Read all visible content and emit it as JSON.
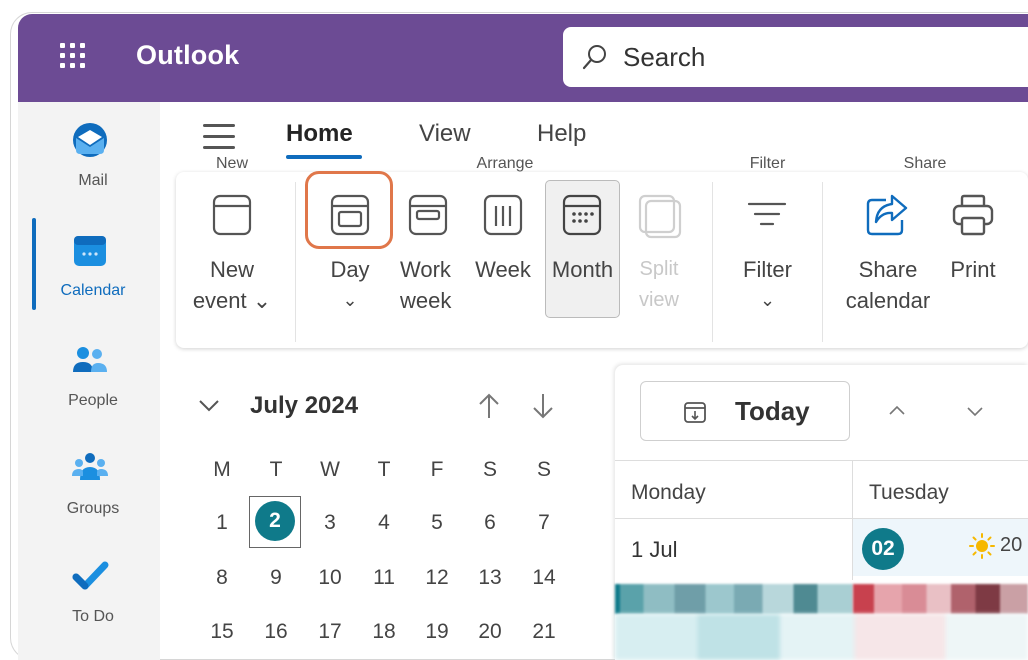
{
  "app": {
    "name": "Outlook"
  },
  "search": {
    "placeholder": "Search"
  },
  "rail": {
    "items": [
      {
        "label": "Mail",
        "icon": "mail-icon"
      },
      {
        "label": "Calendar",
        "icon": "calendar-icon"
      },
      {
        "label": "People",
        "icon": "people-icon"
      },
      {
        "label": "Groups",
        "icon": "groups-icon"
      },
      {
        "label": "To Do",
        "icon": "todo-check-icon"
      }
    ],
    "active": "Calendar"
  },
  "tabs": [
    {
      "label": "Home",
      "active": true
    },
    {
      "label": "View"
    },
    {
      "label": "Help"
    }
  ],
  "ribbon": {
    "new_event": {
      "line1": "New",
      "line2": "event ⌄"
    },
    "day": "Day",
    "work_week": {
      "line1": "Work",
      "line2": "week"
    },
    "week": "Week",
    "month": "Month",
    "split_view": {
      "line1": "Split",
      "line2": "view"
    },
    "filter": "Filter",
    "share_calendar": {
      "line1": "Share",
      "line2": "calendar"
    },
    "print": "Print",
    "groups": {
      "new": "New",
      "arrange": "Arrange",
      "filter": "Filter",
      "share": "Share"
    }
  },
  "mini_calendar": {
    "title": "July 2024",
    "weekdays": [
      "M",
      "T",
      "W",
      "T",
      "F",
      "S",
      "S"
    ],
    "weeks": [
      [
        "1",
        "2",
        "3",
        "4",
        "5",
        "6",
        "7"
      ],
      [
        "8",
        "9",
        "10",
        "11",
        "12",
        "13",
        "14"
      ],
      [
        "15",
        "16",
        "17",
        "18",
        "19",
        "20",
        "21"
      ]
    ],
    "today": "2"
  },
  "main": {
    "today_label": "Today",
    "columns": [
      "Monday",
      "Tuesday"
    ],
    "row_date": "1 Jul",
    "tuesday_badge": "02",
    "weather_temp": "20"
  },
  "colors": {
    "brand": "#6c4b94",
    "accent": "#0f6cbd",
    "today": "#0f7a8a",
    "highlight": "#e0774a"
  }
}
